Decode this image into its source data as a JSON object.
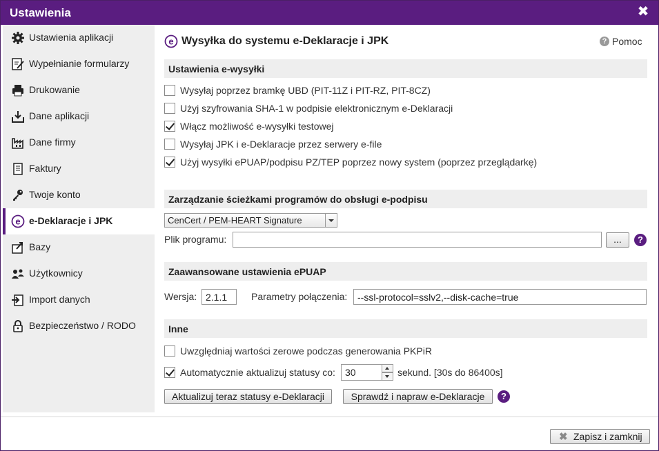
{
  "window": {
    "title": "Ustawienia"
  },
  "sidebar": {
    "items": [
      {
        "label": "Ustawienia aplikacji",
        "icon": "gear-icon"
      },
      {
        "label": "Wypełnianie formularzy",
        "icon": "form-edit-icon"
      },
      {
        "label": "Drukowanie",
        "icon": "printer-icon"
      },
      {
        "label": "Dane aplikacji",
        "icon": "download-tray-icon"
      },
      {
        "label": "Dane firmy",
        "icon": "factory-icon"
      },
      {
        "label": "Faktury",
        "icon": "invoice-icon"
      },
      {
        "label": "Twoje konto",
        "icon": "key-icon"
      },
      {
        "label": "e-Deklaracje i JPK",
        "icon": "e-declaration-icon"
      },
      {
        "label": "Bazy",
        "icon": "database-export-icon"
      },
      {
        "label": "Użytkownicy",
        "icon": "users-icon"
      },
      {
        "label": "Import danych",
        "icon": "import-icon"
      },
      {
        "label": "Bezpieczeństwo / RODO",
        "icon": "lock-icon"
      }
    ],
    "active_index": 7
  },
  "page": {
    "title": "Wysyłka do systemu e-Deklaracje i JPK",
    "help_label": "Pomoc"
  },
  "esend": {
    "heading": "Ustawienia e-wysyłki",
    "options": [
      {
        "label": "Wysyłaj poprzez bramkę UBD (PIT-11Z i PIT-RZ, PIT-8CZ)",
        "checked": false
      },
      {
        "label": "Użyj szyfrowania SHA-1 w podpisie elektronicznym e-Deklaracji",
        "checked": false
      },
      {
        "label": "Włącz możliwość e-wysyłki testowej",
        "checked": true
      },
      {
        "label": "Wysyłaj JPK i e-Deklaracje przez serwery e-file",
        "checked": false
      },
      {
        "label": "Użyj wysyłki ePUAP/podpisu PZ/TEP poprzez nowy system (poprzez przeglądarkę)",
        "checked": true
      }
    ]
  },
  "signature": {
    "heading": "Zarządzanie ścieżkami programów do obsługi e-podpisu",
    "selected_program": "CenCert / PEM-HEART Signature",
    "file_label": "Plik programu:",
    "file_value": "",
    "browse_label": "..."
  },
  "epuap": {
    "heading": "Zaawansowane ustawienia ePUAP",
    "version_label": "Wersja:",
    "version_value": "2.1.1",
    "params_label": "Parametry połączenia:",
    "params_value": "--ssl-protocol=sslv2,--disk-cache=true"
  },
  "other": {
    "heading": "Inne",
    "zero_values": {
      "label": "Uwzględniaj wartości zerowe podczas generowania PKPiR",
      "checked": false
    },
    "auto_update": {
      "label": "Automatycznie aktualizuj statusy co:",
      "checked": true,
      "value": "30",
      "unit": "sekund. [30s do 86400s]"
    },
    "update_now_label": "Aktualizuj teraz statusy e-Deklaracji",
    "check_fix_label": "Sprawdź i napraw e-Deklaracje"
  },
  "footer": {
    "save_close_label": "Zapisz i zamknij"
  },
  "colors": {
    "accent": "#5a1d80",
    "sidebar_bg": "#eeeeee",
    "section_bg": "#eeeeee"
  }
}
